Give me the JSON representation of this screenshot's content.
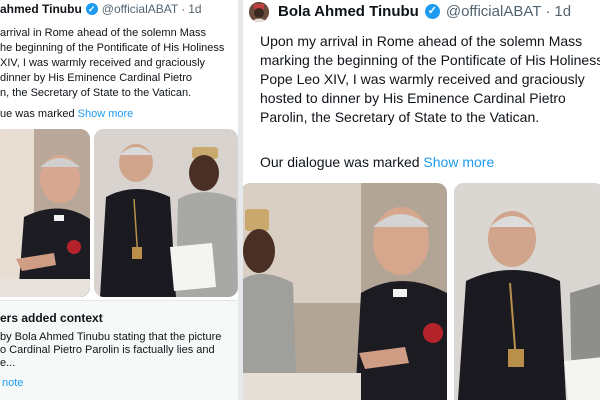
{
  "post": {
    "author_name": "Bola Ahmed Tinubu",
    "handle": "@officialABAT",
    "separator": "·",
    "time": "1d",
    "body_lines": [
      "Upon my arrival in Rome ahead of the solemn Mass",
      "marking the beginning of the Pontificate of His Holiness",
      "Pope Leo XIV, I was warmly received and graciously",
      "hosted to dinner by His Eminence Cardinal Pietro",
      "Parolin, the Secretary of State to the Vatican."
    ],
    "continuation": "Our dialogue was marked",
    "show_more": "Show more",
    "verified_icon": "verified-badge-icon"
  },
  "left_crop": {
    "author_name": "ahmed Tinubu",
    "handle": "@officialABAT",
    "separator": "·",
    "time": "1d",
    "body_lines": [
      "arrival in Rome ahead of the solemn Mass",
      "he beginning of the Pontificate of His Holiness",
      "XIV, I was warmly received and graciously",
      "dinner by His Eminence Cardinal Pietro",
      "n, the Secretary of State to the Vatican."
    ],
    "continuation": "ue was marked",
    "show_more": "Show more"
  },
  "community_note": {
    "heading": "ers added context",
    "lines": [
      "by Bola Ahmed Tinubu stating that the picture",
      "o Cardinal Pietro Parolin is factually lies and",
      "e..."
    ],
    "link": "note"
  },
  "colors": {
    "link": "#1d9bf0",
    "verified": "#1d9bf0",
    "handle": "#536471",
    "text": "#0f1419"
  }
}
